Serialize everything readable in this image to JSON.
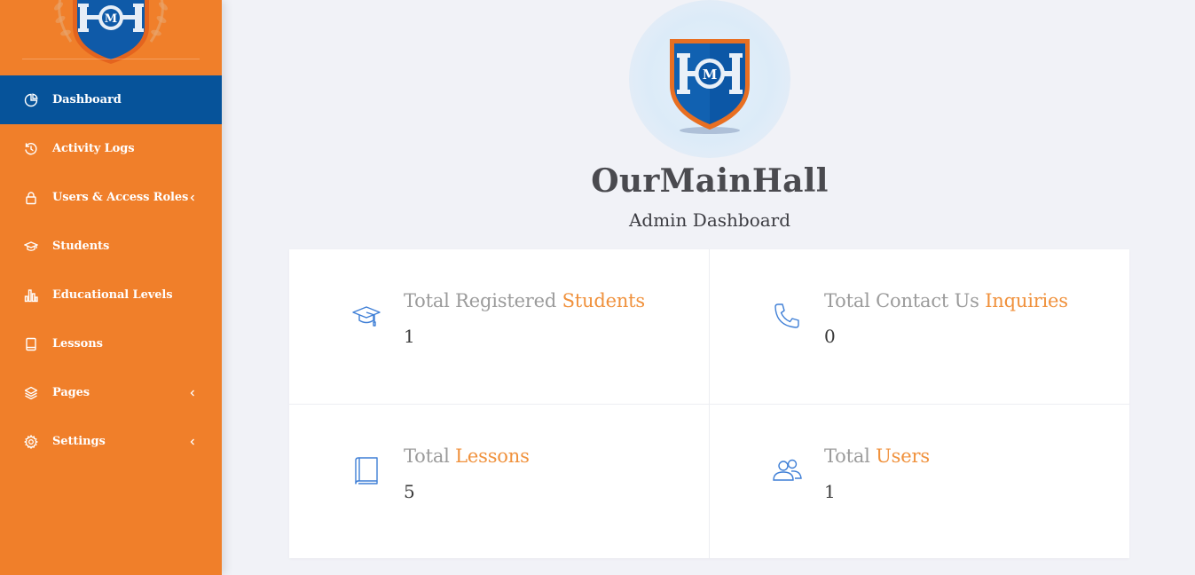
{
  "app": {
    "name": "OurMainHall",
    "subtitle": "Admin Dashboard",
    "logo_letters": "M",
    "colors": {
      "sidebar": "#f07f2a",
      "active": "#06539a",
      "accent": "#f0913c",
      "icon": "#3f7fd6"
    }
  },
  "sidebar": {
    "items": [
      {
        "label": "Dashboard",
        "icon": "pie-chart-icon",
        "active": true,
        "chevron": false
      },
      {
        "label": "Activity Logs",
        "icon": "history-icon",
        "active": false,
        "chevron": false
      },
      {
        "label": "Users & Access Roles",
        "icon": "lock-icon",
        "active": false,
        "chevron": true
      },
      {
        "label": "Students",
        "icon": "graduation-cap-icon",
        "active": false,
        "chevron": false
      },
      {
        "label": "Educational Levels",
        "icon": "bar-chart-icon",
        "active": false,
        "chevron": false
      },
      {
        "label": "Lessons",
        "icon": "book-icon",
        "active": false,
        "chevron": false
      },
      {
        "label": "Pages",
        "icon": "layers-icon",
        "active": false,
        "chevron": true
      },
      {
        "label": "Settings",
        "icon": "gear-icon",
        "active": false,
        "chevron": true
      }
    ]
  },
  "stats": [
    {
      "title_prefix": "Total Registered ",
      "title_accent": "Students",
      "value": "1",
      "icon": "graduation-cap-icon"
    },
    {
      "title_prefix": "Total Contact Us ",
      "title_accent": "Inquiries",
      "value": "0",
      "icon": "phone-icon"
    },
    {
      "title_prefix": "Total ",
      "title_accent": "Lessons",
      "value": "5",
      "icon": "book-icon"
    },
    {
      "title_prefix": "Total ",
      "title_accent": "Users",
      "value": "1",
      "icon": "users-icon"
    }
  ]
}
